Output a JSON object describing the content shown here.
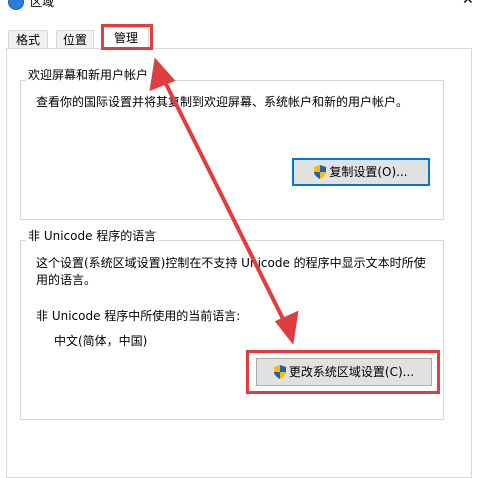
{
  "window": {
    "title": "区域"
  },
  "tabs": [
    {
      "label": "格式"
    },
    {
      "label": "位置"
    },
    {
      "label": "管理"
    }
  ],
  "welcome_group": {
    "title": "欢迎屏幕和新用户帐户",
    "description": "查看你的国际设置并将其复制到欢迎屏幕、系统帐户和新的用户帐户。",
    "copy_button": "复制设置(O)..."
  },
  "unicode_group": {
    "title": "非 Unicode 程序的语言",
    "description_line1": "这个设置(系统区域设置)控制在不支持 Unicode 的程序中显示文本时所使",
    "description_line2": "用的语言。",
    "current_label": "非 Unicode 程序中所使用的当前语言:",
    "current_value": "中文(简体，中国)",
    "change_button": "更改系统区域设置(C)..."
  },
  "icons": {
    "shield": "uac-shield-icon",
    "app": "globe-icon",
    "close": "close-icon"
  },
  "colors": {
    "highlight": "#e03e3e",
    "focus": "#0078d7"
  }
}
